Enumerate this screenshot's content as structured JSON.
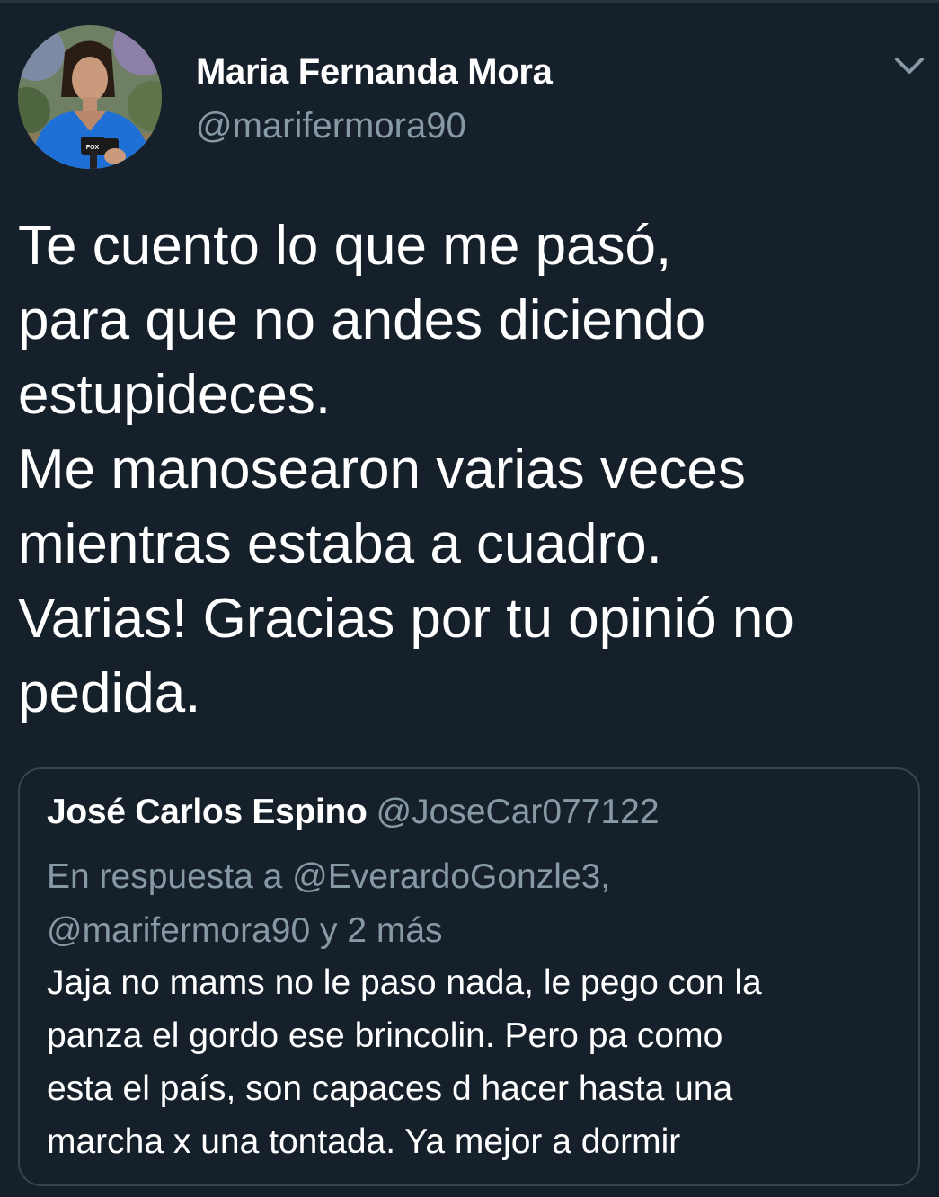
{
  "tweet": {
    "author": {
      "display_name": "Maria Fernanda Mora",
      "handle": "@marifermora90"
    },
    "menu_icon": "chevron-down-icon",
    "text_lines": [
      "Te cuento lo que me pasó,",
      "para que no andes diciendo",
      "estupideces.",
      "Me manosearon varias veces",
      "mientras estaba a cuadro.",
      "Varias! Gracias por tu opinió no",
      "pedida."
    ]
  },
  "quoted_tweet": {
    "author": {
      "display_name": "José Carlos Espino",
      "handle": "@JoseCar077122"
    },
    "reply_to_lines": [
      "En respuesta a @EverardoGonzle3,",
      "@marifermora90 y 2 más"
    ],
    "text_lines": [
      "Jaja no mams no le paso nada, le pego con la",
      "panza el gordo ese brincolin. Pero pa como",
      "esta el país, son capaces d hacer hasta una",
      "marcha x una tontada. Ya mejor a dormir"
    ]
  },
  "colors": {
    "background": "#15202b",
    "primary_text": "#ffffff",
    "secondary_text": "#8899a6",
    "border": "#38444d"
  }
}
